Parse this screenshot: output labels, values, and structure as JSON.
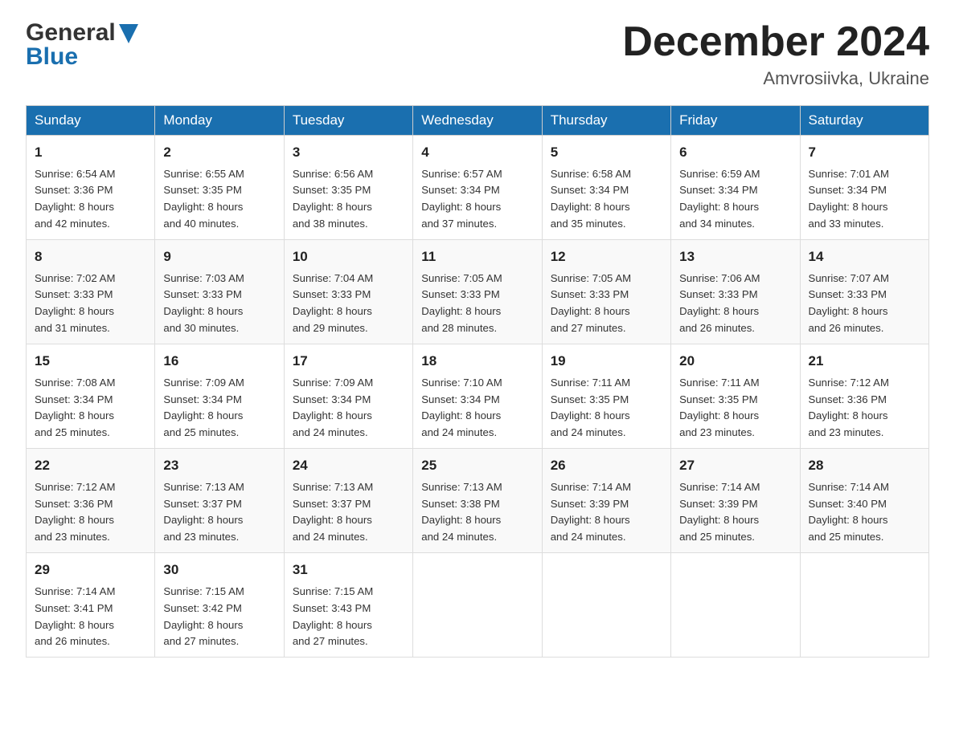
{
  "header": {
    "logo_general": "General",
    "logo_blue": "Blue",
    "title": "December 2024",
    "subtitle": "Amvrosiivka, Ukraine"
  },
  "days_of_week": [
    "Sunday",
    "Monday",
    "Tuesday",
    "Wednesday",
    "Thursday",
    "Friday",
    "Saturday"
  ],
  "weeks": [
    [
      {
        "day": "1",
        "sunrise": "Sunrise: 6:54 AM",
        "sunset": "Sunset: 3:36 PM",
        "daylight": "Daylight: 8 hours",
        "daylight2": "and 42 minutes."
      },
      {
        "day": "2",
        "sunrise": "Sunrise: 6:55 AM",
        "sunset": "Sunset: 3:35 PM",
        "daylight": "Daylight: 8 hours",
        "daylight2": "and 40 minutes."
      },
      {
        "day": "3",
        "sunrise": "Sunrise: 6:56 AM",
        "sunset": "Sunset: 3:35 PM",
        "daylight": "Daylight: 8 hours",
        "daylight2": "and 38 minutes."
      },
      {
        "day": "4",
        "sunrise": "Sunrise: 6:57 AM",
        "sunset": "Sunset: 3:34 PM",
        "daylight": "Daylight: 8 hours",
        "daylight2": "and 37 minutes."
      },
      {
        "day": "5",
        "sunrise": "Sunrise: 6:58 AM",
        "sunset": "Sunset: 3:34 PM",
        "daylight": "Daylight: 8 hours",
        "daylight2": "and 35 minutes."
      },
      {
        "day": "6",
        "sunrise": "Sunrise: 6:59 AM",
        "sunset": "Sunset: 3:34 PM",
        "daylight": "Daylight: 8 hours",
        "daylight2": "and 34 minutes."
      },
      {
        "day": "7",
        "sunrise": "Sunrise: 7:01 AM",
        "sunset": "Sunset: 3:34 PM",
        "daylight": "Daylight: 8 hours",
        "daylight2": "and 33 minutes."
      }
    ],
    [
      {
        "day": "8",
        "sunrise": "Sunrise: 7:02 AM",
        "sunset": "Sunset: 3:33 PM",
        "daylight": "Daylight: 8 hours",
        "daylight2": "and 31 minutes."
      },
      {
        "day": "9",
        "sunrise": "Sunrise: 7:03 AM",
        "sunset": "Sunset: 3:33 PM",
        "daylight": "Daylight: 8 hours",
        "daylight2": "and 30 minutes."
      },
      {
        "day": "10",
        "sunrise": "Sunrise: 7:04 AM",
        "sunset": "Sunset: 3:33 PM",
        "daylight": "Daylight: 8 hours",
        "daylight2": "and 29 minutes."
      },
      {
        "day": "11",
        "sunrise": "Sunrise: 7:05 AM",
        "sunset": "Sunset: 3:33 PM",
        "daylight": "Daylight: 8 hours",
        "daylight2": "and 28 minutes."
      },
      {
        "day": "12",
        "sunrise": "Sunrise: 7:05 AM",
        "sunset": "Sunset: 3:33 PM",
        "daylight": "Daylight: 8 hours",
        "daylight2": "and 27 minutes."
      },
      {
        "day": "13",
        "sunrise": "Sunrise: 7:06 AM",
        "sunset": "Sunset: 3:33 PM",
        "daylight": "Daylight: 8 hours",
        "daylight2": "and 26 minutes."
      },
      {
        "day": "14",
        "sunrise": "Sunrise: 7:07 AM",
        "sunset": "Sunset: 3:33 PM",
        "daylight": "Daylight: 8 hours",
        "daylight2": "and 26 minutes."
      }
    ],
    [
      {
        "day": "15",
        "sunrise": "Sunrise: 7:08 AM",
        "sunset": "Sunset: 3:34 PM",
        "daylight": "Daylight: 8 hours",
        "daylight2": "and 25 minutes."
      },
      {
        "day": "16",
        "sunrise": "Sunrise: 7:09 AM",
        "sunset": "Sunset: 3:34 PM",
        "daylight": "Daylight: 8 hours",
        "daylight2": "and 25 minutes."
      },
      {
        "day": "17",
        "sunrise": "Sunrise: 7:09 AM",
        "sunset": "Sunset: 3:34 PM",
        "daylight": "Daylight: 8 hours",
        "daylight2": "and 24 minutes."
      },
      {
        "day": "18",
        "sunrise": "Sunrise: 7:10 AM",
        "sunset": "Sunset: 3:34 PM",
        "daylight": "Daylight: 8 hours",
        "daylight2": "and 24 minutes."
      },
      {
        "day": "19",
        "sunrise": "Sunrise: 7:11 AM",
        "sunset": "Sunset: 3:35 PM",
        "daylight": "Daylight: 8 hours",
        "daylight2": "and 24 minutes."
      },
      {
        "day": "20",
        "sunrise": "Sunrise: 7:11 AM",
        "sunset": "Sunset: 3:35 PM",
        "daylight": "Daylight: 8 hours",
        "daylight2": "and 23 minutes."
      },
      {
        "day": "21",
        "sunrise": "Sunrise: 7:12 AM",
        "sunset": "Sunset: 3:36 PM",
        "daylight": "Daylight: 8 hours",
        "daylight2": "and 23 minutes."
      }
    ],
    [
      {
        "day": "22",
        "sunrise": "Sunrise: 7:12 AM",
        "sunset": "Sunset: 3:36 PM",
        "daylight": "Daylight: 8 hours",
        "daylight2": "and 23 minutes."
      },
      {
        "day": "23",
        "sunrise": "Sunrise: 7:13 AM",
        "sunset": "Sunset: 3:37 PM",
        "daylight": "Daylight: 8 hours",
        "daylight2": "and 23 minutes."
      },
      {
        "day": "24",
        "sunrise": "Sunrise: 7:13 AM",
        "sunset": "Sunset: 3:37 PM",
        "daylight": "Daylight: 8 hours",
        "daylight2": "and 24 minutes."
      },
      {
        "day": "25",
        "sunrise": "Sunrise: 7:13 AM",
        "sunset": "Sunset: 3:38 PM",
        "daylight": "Daylight: 8 hours",
        "daylight2": "and 24 minutes."
      },
      {
        "day": "26",
        "sunrise": "Sunrise: 7:14 AM",
        "sunset": "Sunset: 3:39 PM",
        "daylight": "Daylight: 8 hours",
        "daylight2": "and 24 minutes."
      },
      {
        "day": "27",
        "sunrise": "Sunrise: 7:14 AM",
        "sunset": "Sunset: 3:39 PM",
        "daylight": "Daylight: 8 hours",
        "daylight2": "and 25 minutes."
      },
      {
        "day": "28",
        "sunrise": "Sunrise: 7:14 AM",
        "sunset": "Sunset: 3:40 PM",
        "daylight": "Daylight: 8 hours",
        "daylight2": "and 25 minutes."
      }
    ],
    [
      {
        "day": "29",
        "sunrise": "Sunrise: 7:14 AM",
        "sunset": "Sunset: 3:41 PM",
        "daylight": "Daylight: 8 hours",
        "daylight2": "and 26 minutes."
      },
      {
        "day": "30",
        "sunrise": "Sunrise: 7:15 AM",
        "sunset": "Sunset: 3:42 PM",
        "daylight": "Daylight: 8 hours",
        "daylight2": "and 27 minutes."
      },
      {
        "day": "31",
        "sunrise": "Sunrise: 7:15 AM",
        "sunset": "Sunset: 3:43 PM",
        "daylight": "Daylight: 8 hours",
        "daylight2": "and 27 minutes."
      },
      null,
      null,
      null,
      null
    ]
  ]
}
